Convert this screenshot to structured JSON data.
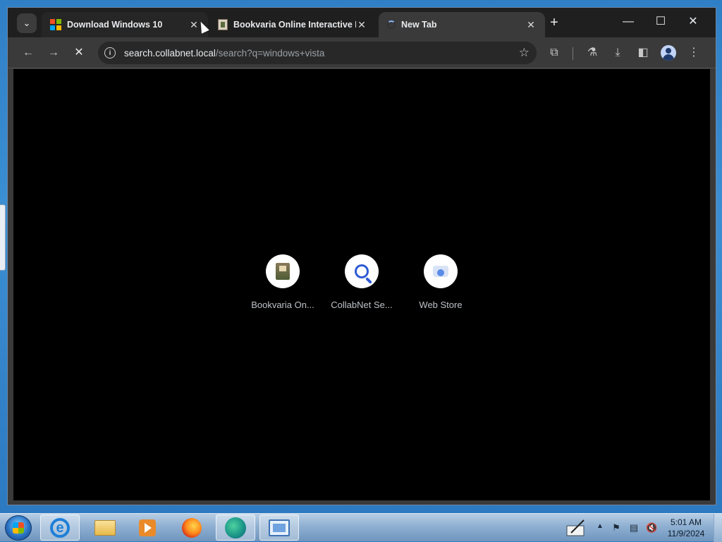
{
  "browser": {
    "tabs": [
      {
        "title": "Download Windows 10",
        "favicon": "microsoft-logo-icon",
        "active": false
      },
      {
        "title": "Bookvaria Online Interactive L",
        "favicon": "bookvaria-favicon",
        "active": false
      },
      {
        "title": "New Tab",
        "favicon": "loading-spinner-icon",
        "active": true
      }
    ],
    "address_bar": {
      "host": "search.collabnet.local",
      "path": "/search?q=windows+vista"
    },
    "accent_color": "#8ab4f8"
  },
  "new_tab": {
    "shortcuts": [
      {
        "label": "Bookvaria On...",
        "icon": "bookvaria-icon"
      },
      {
        "label": "CollabNet Se...",
        "icon": "magnifier-icon"
      },
      {
        "label": "Web Store",
        "icon": "web-store-icon"
      }
    ]
  },
  "taskbar": {
    "pinned": [
      {
        "name": "internet-explorer",
        "icon": "ie-icon"
      },
      {
        "name": "windows-explorer",
        "icon": "folder-icon"
      },
      {
        "name": "media-player",
        "icon": "media-player-icon"
      },
      {
        "name": "firefox",
        "icon": "firefox-icon"
      },
      {
        "name": "edge-chromium",
        "icon": "edge-icon"
      },
      {
        "name": "remote-desktop",
        "icon": "remote-desktop-icon"
      }
    ],
    "clock": {
      "time": "5:01 AM",
      "date": "11/9/2024"
    }
  }
}
